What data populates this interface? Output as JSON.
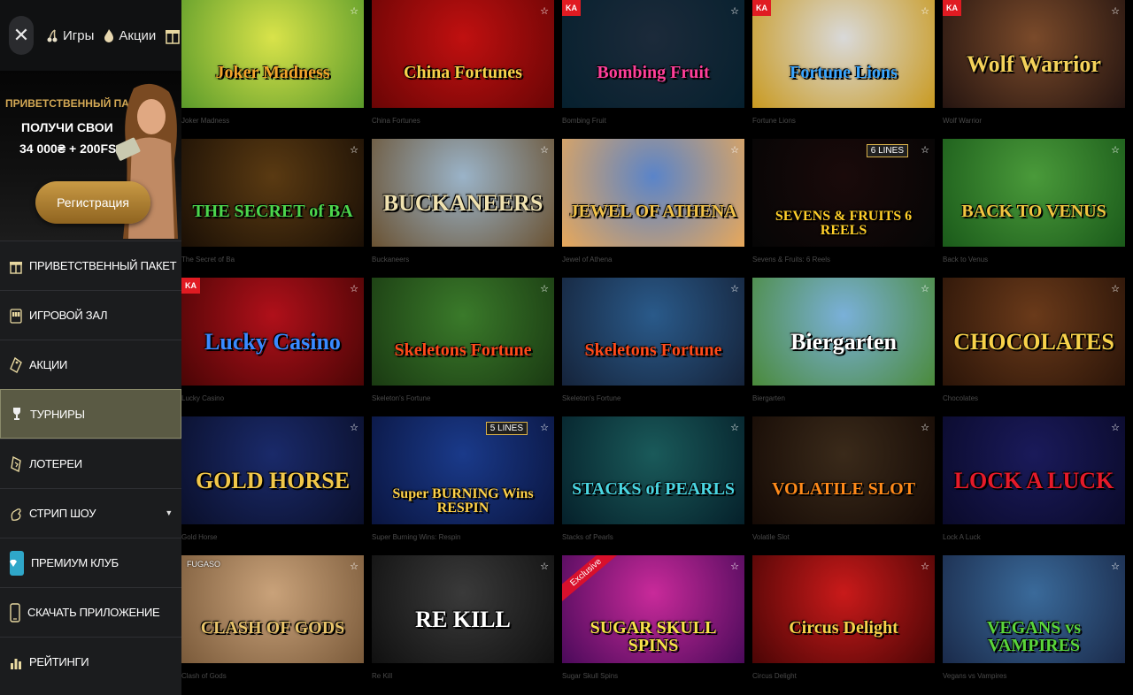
{
  "sidebar": {
    "close_icon": "close-icon",
    "top_links": [
      {
        "label": "Игры",
        "icon": "cherry-icon"
      },
      {
        "label": "Акции",
        "icon": "flame-icon"
      }
    ],
    "gift_icon": "gift-icon",
    "promo": {
      "title": "ПРИВЕТСТВЕННЫЙ ПАКЕТ",
      "line1": "ПОЛУЧИ СВОИ",
      "line2": "34 000₴ + 200FS!",
      "button": "Регистрация"
    },
    "menu": [
      {
        "label": "ПРИВЕТСТВЕННЫЙ ПАКЕТ",
        "icon": "gift-icon"
      },
      {
        "label": "ИГРОВОЙ ЗАЛ",
        "icon": "slot-machine-icon"
      },
      {
        "label": "АКЦИИ",
        "icon": "tag-icon"
      },
      {
        "label": "ТУРНИРЫ",
        "icon": "trophy-icon"
      },
      {
        "label": "ЛОТЕРЕИ",
        "icon": "ticket-icon"
      },
      {
        "label": "СТРИП ШОУ",
        "icon": "hand-icon"
      },
      {
        "label": "ПРЕМИУМ КЛУБ",
        "icon": "diamond-icon"
      },
      {
        "label": "СКАЧАТЬ ПРИЛОЖЕНИЕ",
        "icon": "phone-icon"
      },
      {
        "label": "РЕЙТИНГИ",
        "icon": "chart-icon"
      }
    ],
    "caret": "▼"
  },
  "games": [
    {
      "title": "Joker Madness",
      "thumb": "Joker Madness",
      "colors": [
        "#d9e34a",
        "#5a9a2a"
      ],
      "tcolor": "#f2a42b"
    },
    {
      "title": "China Fortunes",
      "thumb": "China Fortunes",
      "colors": [
        "#c01010",
        "#6a0505"
      ],
      "tcolor": "#f7d24a"
    },
    {
      "title": "Bombing Fruit",
      "thumb": "Bombing Fruit",
      "colors": [
        "#1c2a3a",
        "#06202e"
      ],
      "tcolor": "#ff3f9a",
      "tag": "KA"
    },
    {
      "title": "Fortune Lions",
      "thumb": "Fortune Lions",
      "colors": [
        "#d9d9d9",
        "#c99a20"
      ],
      "tcolor": "#3aa6ff",
      "tag": "KA"
    },
    {
      "title": "Wolf Warrior",
      "thumb": "Wolf Warrior",
      "colors": [
        "#7a4a2a",
        "#241410"
      ],
      "tcolor": "#f4d25a",
      "tag": "KA"
    },
    {
      "title": "The Secret of Ba",
      "thumb": "THE SECRET of BA",
      "colors": [
        "#5a3a12",
        "#1a0f05"
      ],
      "tcolor": "#4cd64c"
    },
    {
      "title": "Buckaneers",
      "thumb": "BUCKANEERS",
      "colors": [
        "#9ab3c8",
        "#6a5232"
      ],
      "tcolor": "#f0e2b0"
    },
    {
      "title": "Jewel of Athena",
      "thumb": "JEWEL OF ATHENA",
      "colors": [
        "#5a84c9",
        "#e8a85a"
      ],
      "tcolor": "#f1c24a"
    },
    {
      "title": "Sevens & Fruits: 6 Reels",
      "thumb": "SEVENS & FRUITS 6 REELS",
      "colors": [
        "#1a0a0a",
        "#050505"
      ],
      "tcolor": "#ffcf2a",
      "lines": "6 LINES"
    },
    {
      "title": "Back to Venus",
      "thumb": "BACK TO VENUS",
      "colors": [
        "#4a9a3a",
        "#1a5a1a"
      ],
      "tcolor": "#f2c640"
    },
    {
      "title": "Lucky Casino",
      "thumb": "Lucky Casino",
      "colors": [
        "#b0101a",
        "#4a0505"
      ],
      "tcolor": "#3a8aff",
      "tag": "KA"
    },
    {
      "title": "Skeleton's Fortune",
      "thumb": "Skeletons Fortune",
      "colors": [
        "#3a7a2a",
        "#1a3a12"
      ],
      "tcolor": "#ff4a1a"
    },
    {
      "title": "Skeleton's Fortune",
      "thumb": "Skeletons Fortune",
      "colors": [
        "#2a5a8a",
        "#15233a"
      ],
      "tcolor": "#ff4a1a"
    },
    {
      "title": "Biergarten",
      "thumb": "Biergarten",
      "colors": [
        "#7ab0d9",
        "#4a8a3a"
      ],
      "tcolor": "#ffffff"
    },
    {
      "title": "Chocolates",
      "thumb": "CHOCOLATES",
      "colors": [
        "#6a3a1a",
        "#2a1408"
      ],
      "tcolor": "#f8d24a"
    },
    {
      "title": "Gold Horse",
      "thumb": "GOLD HORSE",
      "colors": [
        "#1a2a6a",
        "#0a0f2a"
      ],
      "tcolor": "#f2c84a"
    },
    {
      "title": "Super Burning Wins: Respin",
      "thumb": "Super BURNING Wins RESPIN",
      "colors": [
        "#1a3a8a",
        "#0a1540"
      ],
      "tcolor": "#ffd24a",
      "lines": "5 LINES"
    },
    {
      "title": "Stacks of Pearls",
      "thumb": "STACKS of PEARLS",
      "colors": [
        "#1a5a5a",
        "#05202a"
      ],
      "tcolor": "#4ad6e2"
    },
    {
      "title": "Volatile Slot",
      "thumb": "VOLATILE SLOT",
      "colors": [
        "#3a2a1a",
        "#150a05"
      ],
      "tcolor": "#ff8a1a"
    },
    {
      "title": "Lock A Luck",
      "thumb": "LOCK A LUCK",
      "colors": [
        "#1a1a5a",
        "#0a0a2a"
      ],
      "tcolor": "#e51a2a"
    },
    {
      "title": "Clash of Gods",
      "thumb": "CLASH OF GODS",
      "colors": [
        "#c9a27a",
        "#7a5a3a"
      ],
      "tcolor": "#e8c46a",
      "brand": "FUGASO"
    },
    {
      "title": "Re Kill",
      "thumb": "RE KILL",
      "colors": [
        "#3a3a3a",
        "#101010"
      ],
      "tcolor": "#ffffff"
    },
    {
      "title": "Sugar Skull Spins",
      "thumb": "SUGAR SKULL SPINS",
      "colors": [
        "#c92a9a",
        "#4a0a5a"
      ],
      "tcolor": "#f8e24a",
      "exclusive": "Exclusive"
    },
    {
      "title": "Circus Delight",
      "thumb": "Circus Delight",
      "colors": [
        "#c91a1a",
        "#4a0505"
      ],
      "tcolor": "#f8d24a"
    },
    {
      "title": "Vegans vs Vampires",
      "thumb": "VEGANS vs VAMPIRES",
      "colors": [
        "#3a6a9a",
        "#1a2a4a"
      ],
      "tcolor": "#5ad63a"
    }
  ]
}
